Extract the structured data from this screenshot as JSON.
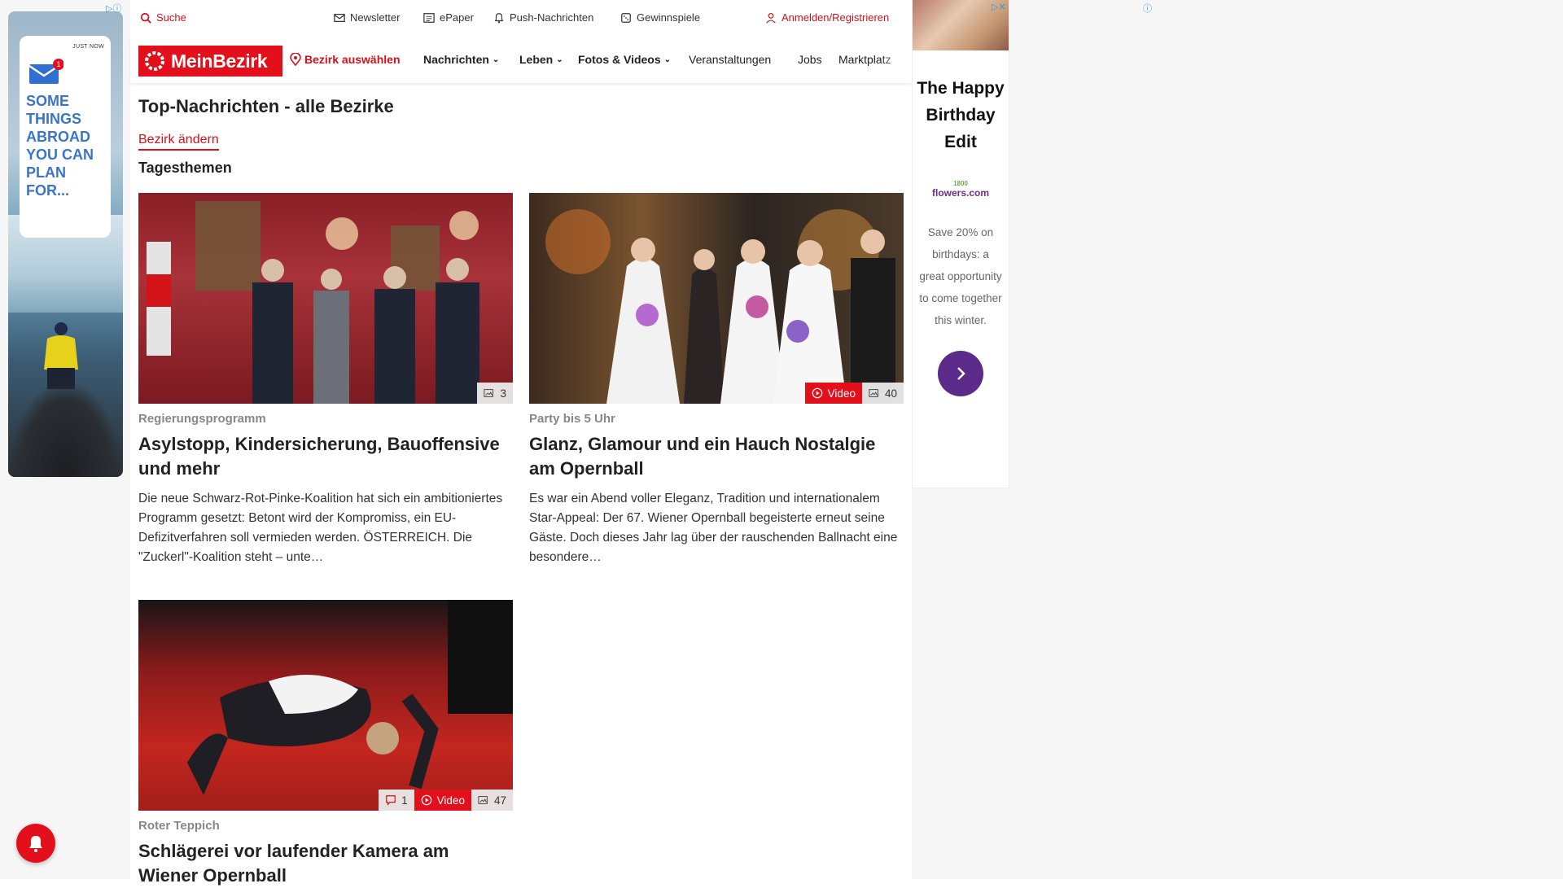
{
  "util": {
    "search": "Suche",
    "newsletter": "Newsletter",
    "epaper": "ePaper",
    "push": "Push-Nachrichten",
    "gewinnspiele": "Gewinnspiele",
    "login": "Anmelden/Registrieren"
  },
  "nav": {
    "logo": "MeinBezirk",
    "bezirk": "Bezirk auswählen",
    "nachrichten": "Nachrichten",
    "leben": "Leben",
    "fotos": "Fotos & Videos",
    "veranstaltungen": "Veranstaltungen",
    "jobs": "Jobs",
    "marktplatz": "Marktplatz"
  },
  "page": {
    "title": "Top-Nachrichten - alle Bezirke",
    "change_link": "Bezirk ändern",
    "section": "Tagesthemen"
  },
  "articles": [
    {
      "kicker": "Regierungsprogramm",
      "headline": "Asylstopp, Kindersicherung, Bauoffensive und mehr",
      "teaser": "Die neue Schwarz-Rot-Pinke-Koalition hat sich ein ambitioniertes Programm gesetzt: Betont wird der Kompromiss, ein EU-Defizitverfahren soll vermieden werden.  ÖSTERREICH. Die \"Zuckerl\"-Koalition steht – unte…",
      "photos": "3"
    },
    {
      "kicker": "Party bis 5 Uhr",
      "headline": "Glanz, Glamour und ein Hauch Nostalgie am Opernball",
      "teaser": "Es war ein Abend voller Eleganz, Tradition und internationalem Star-Appeal: Der 67. Wiener Opernball begeisterte erneut seine Gäste. Doch dieses Jahr lag über der rauschenden Ballnacht eine besondere…",
      "video": "Video",
      "photos": "40"
    },
    {
      "kicker": "Roter Teppich",
      "headline": "Schlägerei vor laufender Kamera am Wiener Opernball",
      "comments": "1",
      "video": "Video",
      "photos": "47"
    }
  ],
  "left_ad": {
    "just_now": "JUST NOW",
    "badge": "1",
    "text": "SOME THINGS ABROAD YOU CAN PLAN FOR..."
  },
  "right_ad": {
    "headline": "The Happy Birthday Edit",
    "brand_small": "1800",
    "brand": "flowers.com",
    "body": "Save 20% on birthdays: a great opportunity to come together this winter."
  },
  "colors": {
    "brand_red": "#e3101b",
    "ad_purple": "#5b2a8a"
  }
}
